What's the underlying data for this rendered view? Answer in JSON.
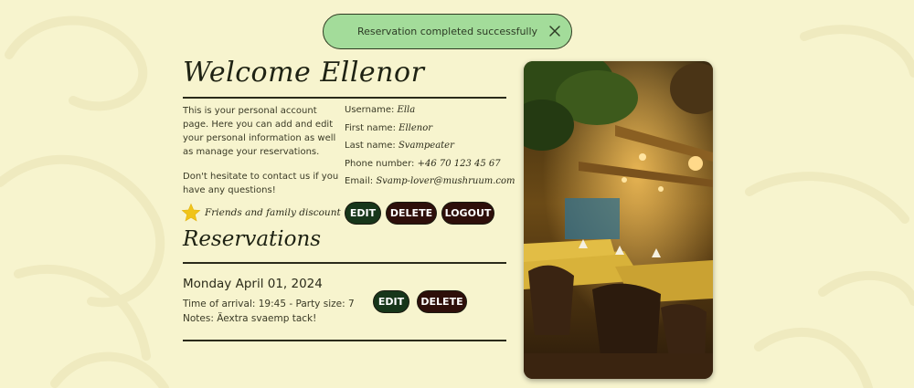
{
  "toast": {
    "message": "Reservation completed successfully"
  },
  "header": {
    "title": "Welcome Ellenor"
  },
  "intro": {
    "paragraph1": "This is your personal account page. Here you can add and edit your personal information as well as manage your reservations.",
    "paragraph2": "Don't hesitate to contact us if you have any questions!"
  },
  "discount": {
    "label": "Friends and family discount",
    "icon": "star-icon",
    "color": "#f0c419"
  },
  "account": {
    "username_label": "Username:",
    "username": "Ella",
    "first_name_label": "First name:",
    "first_name": "Ellenor",
    "last_name_label": "Last name:",
    "last_name": "Svampeater",
    "phone_label": "Phone number:",
    "phone": "+46 70 123 45 67",
    "email_label": "Email:",
    "email": "Svamp-lover@mushruum.com"
  },
  "buttons": {
    "edit": "EDIT",
    "delete": "DELETE",
    "logout": "LOGOUT"
  },
  "reservations": {
    "title": "Reservations",
    "items": [
      {
        "date": "Monday April 01, 2024",
        "details": "Time of arrival: 19:45 - Party size: 7",
        "notes": "Notes: Äextra svaemp tack!",
        "edit": "EDIT",
        "delete": "DELETE"
      }
    ]
  },
  "colors": {
    "background": "#f7f4ce",
    "toast": "#a3dc9a",
    "primary_button": "#17361a",
    "danger_button": "#2e0f0a"
  }
}
